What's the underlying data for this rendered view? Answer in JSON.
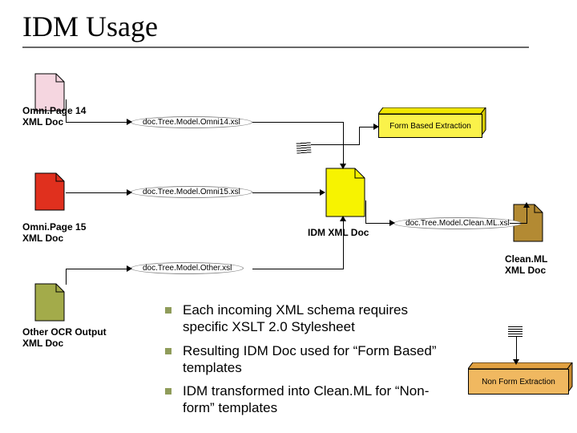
{
  "title": "IDM Usage",
  "docs": {
    "omni14": "Omni.Page 14 XML Doc",
    "omni15": "Omni.Page 15 XML Doc",
    "other": "Other OCR Output XML Doc",
    "idm": "IDM XML Doc",
    "cleanml": "Clean.ML XML Doc"
  },
  "xsl": {
    "omni14": "doc.Tree.Model.Omni14.xsl",
    "omni15": "doc.Tree.Model.Omni15.xsl",
    "other": "doc.Tree.Model.Other.xsl",
    "cleanml": "doc.Tree.Model.Clean.ML.xsl"
  },
  "boxes": {
    "form": "Form Based Extraction",
    "nonform": "Non Form Extraction"
  },
  "bullets": [
    "Each incoming XML schema requires specific XSLT 2.0 Stylesheet",
    "Resulting IDM Doc used for “Form Based” templates",
    "IDM transformed into Clean.ML for “Non-form” templates"
  ]
}
